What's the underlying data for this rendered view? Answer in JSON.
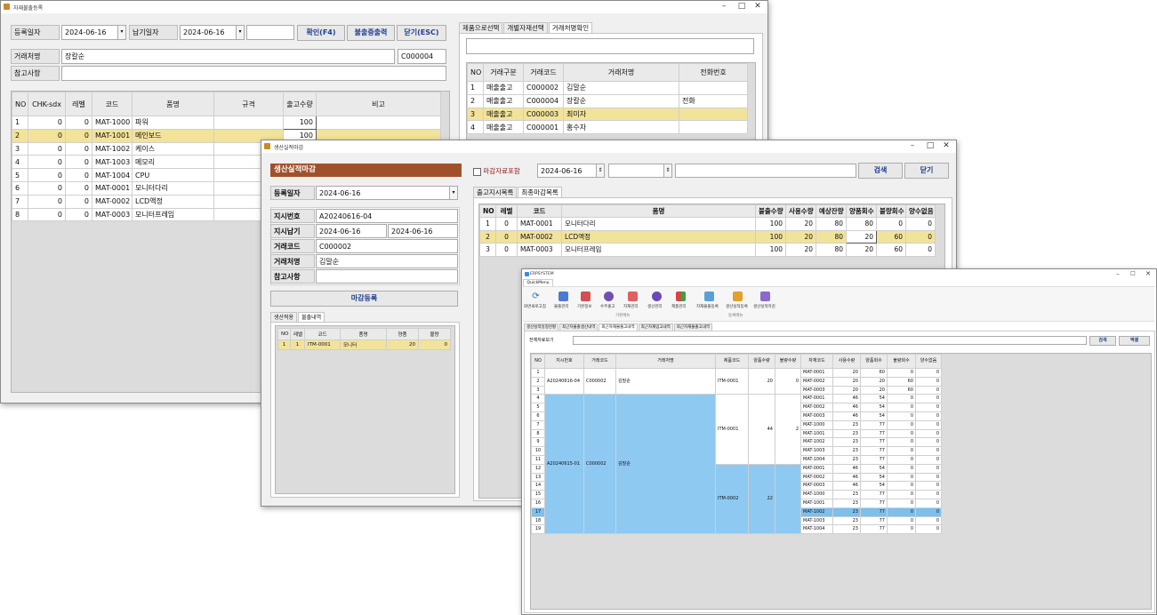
{
  "win1": {
    "title": "자재불출등록",
    "reg_date_label": "등록일자",
    "reg_date": "2024-06-16",
    "due_date_label": "납기일자",
    "due_date": "2024-06-16",
    "btn_confirm": "확인(F4)",
    "btn_print": "불출증출력",
    "btn_close": "닫기(ESC)",
    "vendor_label": "거래처명",
    "vendor_name": "장칼순",
    "vendor_code": "C000004",
    "memo_label": "참고사항",
    "tabs": [
      "제품으로선택",
      "개별자재선택",
      "거래처명확인"
    ],
    "grid": {
      "headers": [
        "NO",
        "CHK-sdx",
        "레벨",
        "코드",
        "품명",
        "규격",
        "출고수량",
        "비고"
      ],
      "rows": [
        [
          "1",
          "0",
          "0",
          "MAT-1000",
          "파워",
          "",
          "100",
          ""
        ],
        [
          "2",
          "0",
          "0",
          "MAT-1001",
          "메인보드",
          "",
          "100",
          ""
        ],
        [
          "3",
          "0",
          "0",
          "MAT-1002",
          "케이스",
          "",
          "",
          ""
        ],
        [
          "4",
          "0",
          "0",
          "MAT-1003",
          "메모리",
          "",
          "",
          ""
        ],
        [
          "5",
          "0",
          "0",
          "MAT-1004",
          "CPU",
          "",
          "",
          ""
        ],
        [
          "6",
          "0",
          "0",
          "MAT-0001",
          "모니터다리",
          "",
          "",
          ""
        ],
        [
          "7",
          "0",
          "0",
          "MAT-0002",
          "LCD액정",
          "",
          "",
          ""
        ],
        [
          "8",
          "0",
          "0",
          "MAT-0003",
          "모니터프레임",
          "",
          "",
          ""
        ]
      ]
    },
    "vgrid": {
      "headers": [
        "NO",
        "거래구분",
        "거래코드",
        "거래처명",
        "전화번호"
      ],
      "rows": [
        [
          "1",
          "매출출고",
          "C000002",
          "김말순",
          ""
        ],
        [
          "2",
          "매출출고",
          "C000004",
          "장칼순",
          "전화"
        ],
        [
          "3",
          "매출출고",
          "C000003",
          "최미자",
          ""
        ],
        [
          "4",
          "매출출고",
          "C000001",
          "홍수자",
          ""
        ]
      ]
    }
  },
  "win2": {
    "title": "생산실적마감",
    "header": "생산실적마감",
    "reg_date_label": "등록일자",
    "reg_date": "2024-06-16",
    "order_no_label": "지시번호",
    "order_no": "A20240616-04",
    "order_due_label": "지시납기",
    "order_due_from": "2024-06-16",
    "order_due_to": "2024-06-16",
    "vendor_code_label": "거래코드",
    "vendor_code": "C000002",
    "vendor_name_label": "거래처명",
    "vendor_name": "김말순",
    "memo_label": "참고사항",
    "btn_close_reg": "마감등록",
    "sub_tabs": [
      "생산적용",
      "불출내역"
    ],
    "sub_grid": {
      "headers": [
        "NO",
        "레벨",
        "코드",
        "품명",
        "양품",
        "불량"
      ],
      "rows": [
        [
          "1",
          "1",
          "ITM-0001",
          "모니터",
          "20",
          "0"
        ]
      ]
    },
    "chk_label": "마감자료포함",
    "search_date": "2024-06-16",
    "btn_search": "검색",
    "btn_close": "닫기",
    "tabs": [
      "출고지시목록",
      "최종마감목록"
    ],
    "grid": {
      "headers": [
        "NO",
        "레벨",
        "코드",
        "품명",
        "불출수량",
        "사용수량",
        "예상잔량",
        "양품회수",
        "불량회수",
        "양수없음"
      ],
      "rows": [
        [
          "1",
          "0",
          "MAT-0001",
          "모니터다리",
          "100",
          "20",
          "80",
          "80",
          "0",
          "0"
        ],
        [
          "2",
          "0",
          "MAT-0002",
          "LCD액정",
          "100",
          "20",
          "80",
          "20",
          "60",
          "0"
        ],
        [
          "3",
          "0",
          "MAT-0003",
          "모니터프레임",
          "100",
          "20",
          "80",
          "20",
          "60",
          "0"
        ]
      ]
    }
  },
  "win3": {
    "title": "ERPSYSTEM",
    "qm_tab": "QuickMenu",
    "ribbon": [
      "화면새로고침",
      "불출관리",
      "기본정보",
      "수주출고",
      "자재관리",
      "생산관리",
      "제품관리",
      "자재불출등록",
      "생산실적등록",
      "생산실적마감"
    ],
    "group1": "기본메뉴",
    "group2": "등록메뉴",
    "tabs": [
      "생산실적일정현황",
      "최근자불출생산내역",
      "최근자재불출고내역",
      "최근자재입고내역",
      "최근자재불출고내역"
    ],
    "search_label": "전체자료보기",
    "btn_search": "검색",
    "btn_excel": "엑셀",
    "grid_headers": [
      "NO",
      "지시번호",
      "거래코드",
      "거래처명",
      "제품코드",
      "양품수량",
      "불량수량",
      "자재코드",
      "사용수량",
      "양품회수",
      "불량회수",
      "양수없음"
    ],
    "g1": {
      "order": "A20240616-04",
      "vcode": "C000002",
      "vname": "김말순",
      "item": "ITM-0001",
      "good": "20",
      "bad": "0"
    },
    "g2": {
      "order": "A20240615-01",
      "vcode": "C000002",
      "vname": "김말순"
    },
    "g2a": {
      "item": "ITM-0001",
      "good": "44",
      "bad": "2"
    },
    "g2b": {
      "item": "ITM-0002",
      "good": "22",
      "bad": ""
    },
    "rows": [
      [
        "1",
        "MAT-0001",
        "20",
        "60",
        "0",
        "0"
      ],
      [
        "2",
        "MAT-0002",
        "20",
        "20",
        "60",
        "0"
      ],
      [
        "3",
        "MAT-0003",
        "20",
        "20",
        "60",
        "0"
      ],
      [
        "4",
        "MAT-0001",
        "46",
        "54",
        "0",
        "0"
      ],
      [
        "5",
        "MAT-0002",
        "46",
        "54",
        "0",
        "0"
      ],
      [
        "6",
        "MAT-0003",
        "46",
        "54",
        "0",
        "0"
      ],
      [
        "7",
        "MAT-1000",
        "23",
        "77",
        "0",
        "0"
      ],
      [
        "8",
        "MAT-1001",
        "23",
        "77",
        "0",
        "0"
      ],
      [
        "9",
        "MAT-1002",
        "23",
        "77",
        "0",
        "0"
      ],
      [
        "10",
        "MAT-1003",
        "23",
        "77",
        "0",
        "0"
      ],
      [
        "11",
        "MAT-1004",
        "23",
        "77",
        "0",
        "0"
      ],
      [
        "12",
        "MAT-0001",
        "46",
        "54",
        "0",
        "0"
      ],
      [
        "13",
        "MAT-0002",
        "46",
        "54",
        "0",
        "0"
      ],
      [
        "14",
        "MAT-0003",
        "46",
        "54",
        "0",
        "0"
      ],
      [
        "15",
        "MAT-1000",
        "23",
        "77",
        "0",
        "0"
      ],
      [
        "16",
        "MAT-1001",
        "23",
        "77",
        "0",
        "0"
      ],
      [
        "17",
        "MAT-1002",
        "23",
        "77",
        "0",
        "0"
      ],
      [
        "18",
        "MAT-1003",
        "23",
        "77",
        "0",
        "0"
      ],
      [
        "19",
        "MAT-1004",
        "23",
        "77",
        "0",
        "0"
      ]
    ]
  }
}
